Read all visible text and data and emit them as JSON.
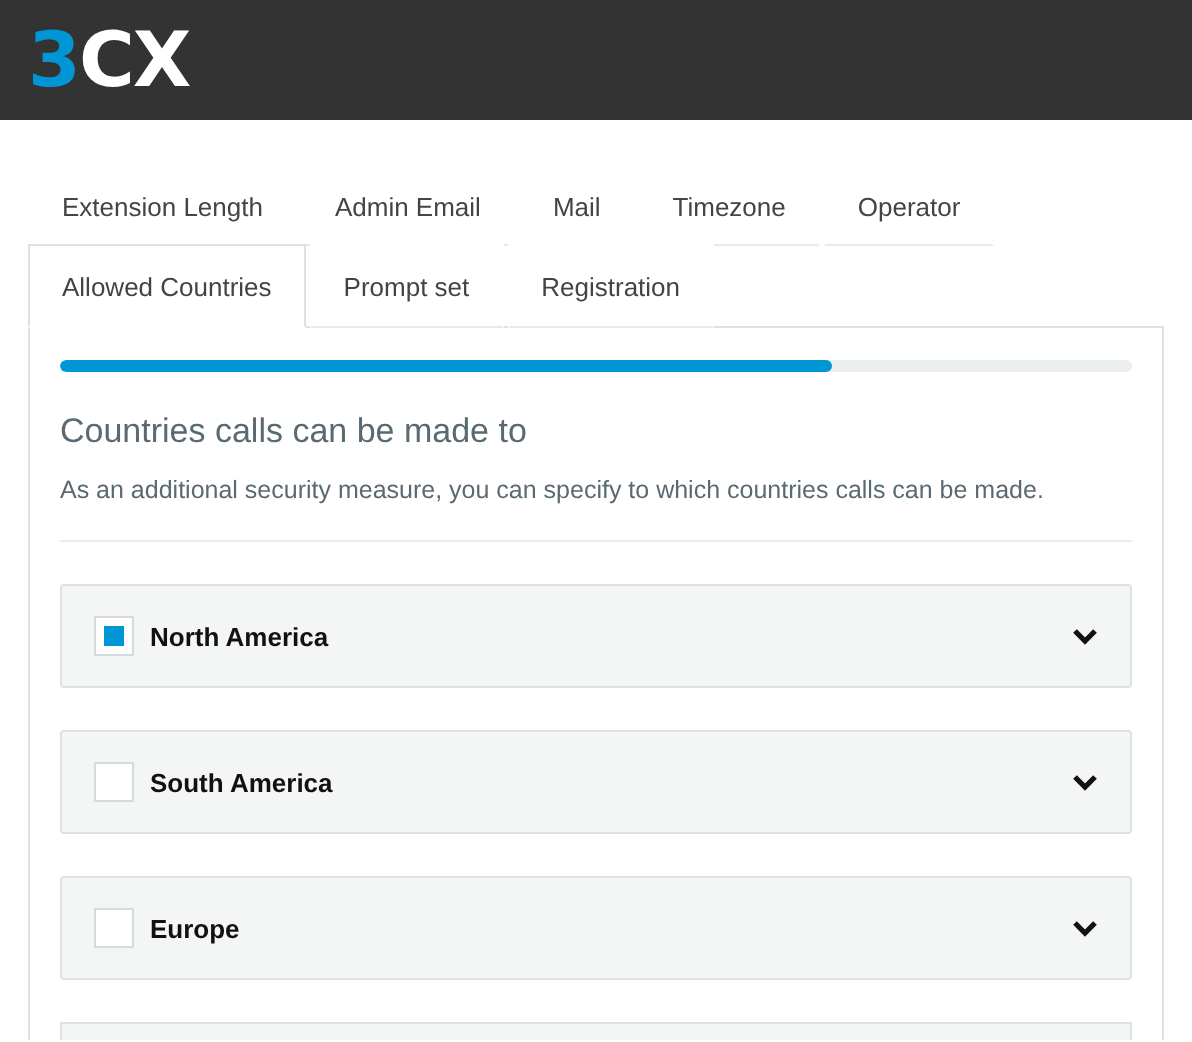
{
  "header": {
    "logo": "3CX"
  },
  "tab_rows": [
    [
      {
        "label": "Extension Length",
        "selected": false
      },
      {
        "label": "Admin Email",
        "selected": false
      },
      {
        "label": "Mail",
        "selected": false
      },
      {
        "label": "Timezone",
        "selected": false
      },
      {
        "label": "Operator",
        "selected": false
      }
    ],
    [
      {
        "label": "Allowed Countries",
        "selected": true
      },
      {
        "label": "Prompt set",
        "selected": false
      },
      {
        "label": "Registration",
        "selected": false
      }
    ]
  ],
  "progress": {
    "level": 0.72
  },
  "section": {
    "title": "Countries calls can be made to",
    "description": "As an additional security measure, you can specify to which countries calls can be made."
  },
  "regions": [
    {
      "name": "North America",
      "checked": true,
      "expanded": false
    },
    {
      "name": "South America",
      "checked": false,
      "expanded": false
    },
    {
      "name": "Europe",
      "checked": false,
      "expanded": false
    }
  ]
}
